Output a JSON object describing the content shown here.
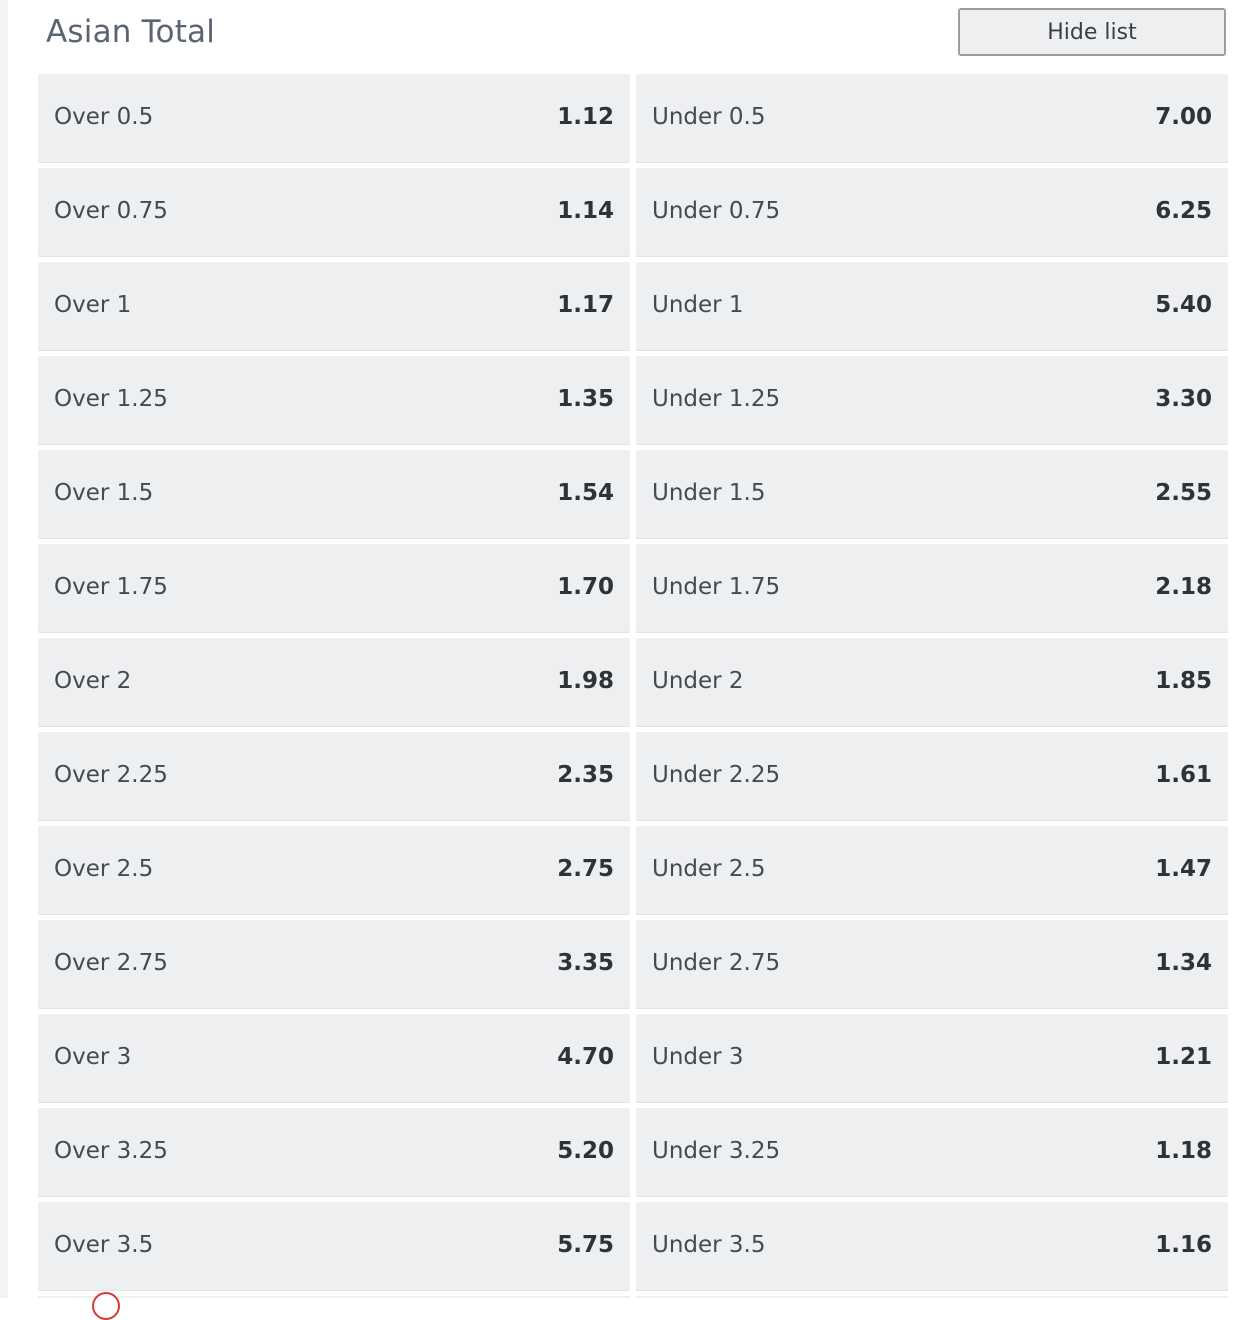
{
  "header": {
    "title": "Asian Total",
    "hide_button_label": "Hide list"
  },
  "rows": [
    {
      "over_label": "Over 0.5",
      "over_odd": "1.12",
      "under_label": "Under 0.5",
      "under_odd": "7.00"
    },
    {
      "over_label": "Over 0.75",
      "over_odd": "1.14",
      "under_label": "Under 0.75",
      "under_odd": "6.25"
    },
    {
      "over_label": "Over 1",
      "over_odd": "1.17",
      "under_label": "Under 1",
      "under_odd": "5.40"
    },
    {
      "over_label": "Over 1.25",
      "over_odd": "1.35",
      "under_label": "Under 1.25",
      "under_odd": "3.30"
    },
    {
      "over_label": "Over 1.5",
      "over_odd": "1.54",
      "under_label": "Under 1.5",
      "under_odd": "2.55"
    },
    {
      "over_label": "Over 1.75",
      "over_odd": "1.70",
      "under_label": "Under 1.75",
      "under_odd": "2.18"
    },
    {
      "over_label": "Over 2",
      "over_odd": "1.98",
      "under_label": "Under 2",
      "under_odd": "1.85"
    },
    {
      "over_label": "Over 2.25",
      "over_odd": "2.35",
      "under_label": "Under 2.25",
      "under_odd": "1.61"
    },
    {
      "over_label": "Over 2.5",
      "over_odd": "2.75",
      "under_label": "Under 2.5",
      "under_odd": "1.47"
    },
    {
      "over_label": "Over 2.75",
      "over_odd": "3.35",
      "under_label": "Under 2.75",
      "under_odd": "1.34"
    },
    {
      "over_label": "Over 3",
      "over_odd": "4.70",
      "under_label": "Under 3",
      "under_odd": "1.21"
    },
    {
      "over_label": "Over 3.25",
      "over_odd": "5.20",
      "under_label": "Under 3.25",
      "under_odd": "1.18"
    },
    {
      "over_label": "Over 3.5",
      "over_odd": "5.75",
      "under_label": "Under 3.5",
      "under_odd": "1.16"
    }
  ]
}
